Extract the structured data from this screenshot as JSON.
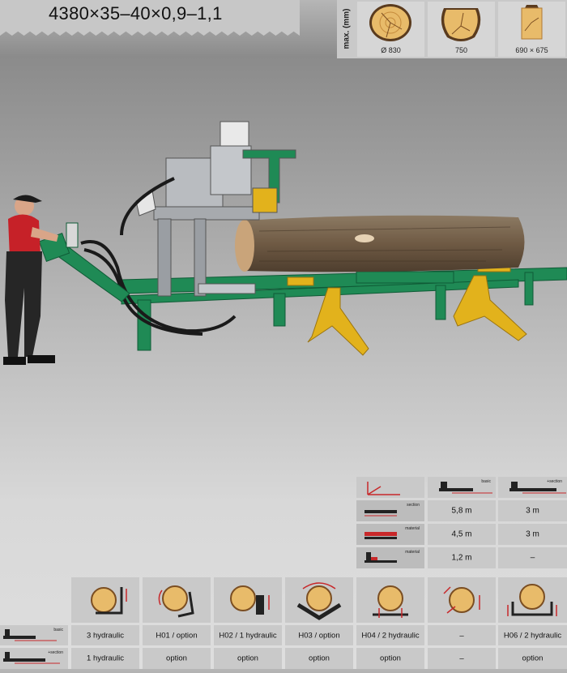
{
  "header": {
    "title": "4380×35–40×0,9–1,1"
  },
  "max_panel": {
    "label": "max. (mm)",
    "items": [
      {
        "icon": "round-log-icon",
        "value": "Ø 830"
      },
      {
        "icon": "flattened-log-icon",
        "value": "750"
      },
      {
        "icon": "squared-log-icon",
        "value": "690 × 675"
      }
    ]
  },
  "spec_table": {
    "header_icons": [
      "axis-icon",
      "basic-bed-icon",
      "extension-bed-icon"
    ],
    "header_labels": [
      "basic",
      "+section"
    ],
    "rows": [
      {
        "icon": "section-icon",
        "icon_label": "section",
        "values": [
          "5,8 m",
          "3 m"
        ]
      },
      {
        "icon": "material-icon",
        "icon_label": "material",
        "values": [
          "4,5 m",
          "3 m"
        ]
      },
      {
        "icon": "material-min-icon",
        "icon_label": "material",
        "values": [
          "1,2 m",
          "–"
        ]
      }
    ]
  },
  "bottom_table": {
    "columns": [
      "log-clamp-hydraulic-icon",
      "log-roll-left-icon",
      "log-roll-right-icon",
      "log-turner-icon",
      "log-support-icon",
      "log-rotate-icon",
      "log-lift-icon"
    ],
    "rows": [
      {
        "icon": "basic-row-icon",
        "label": "basic",
        "values": [
          "3 hydraulic",
          "H01 / option",
          "H02 / 1 hydraulic",
          "H03 / option",
          "H04 / 2 hydraulic",
          "–",
          "H06 / 2 hydraulic"
        ]
      },
      {
        "icon": "section-row-icon",
        "label": "+section",
        "values": [
          "1 hydraulic",
          "option",
          "option",
          "option",
          "option",
          "–",
          "option"
        ]
      }
    ]
  },
  "colors": {
    "machine_green": "#1f8a55",
    "support_yellow": "#e2b21c",
    "arrow_red": "#c8282a"
  }
}
